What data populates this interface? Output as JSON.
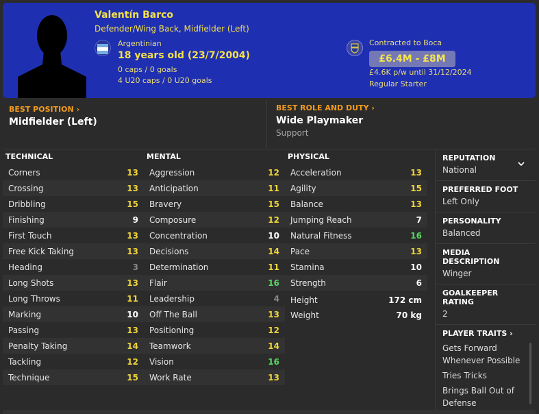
{
  "player": {
    "name": "Valentín Barco",
    "positions": "Defender/Wing Back, Midfielder (Left)",
    "nationality": "Argentinian",
    "age": "18 years old (23/7/2004)",
    "caps": "0 caps / 0 goals",
    "u20_caps": "4 U20 caps / 0 U20 goals",
    "contract": "Contracted to Boca",
    "value": "£6.4M - £8M",
    "wage": "£4.6K p/w until 31/12/2024",
    "status": "Regular Starter"
  },
  "best_position": {
    "label": "BEST POSITION ›",
    "value": "Midfielder (Left)"
  },
  "best_role": {
    "label": "BEST ROLE AND DUTY ›",
    "value": "Wide Playmaker",
    "duty": "Support"
  },
  "technical": {
    "title": "TECHNICAL",
    "rows": [
      {
        "name": "Corners",
        "value": "13",
        "color": "yellow"
      },
      {
        "name": "Crossing",
        "value": "13",
        "color": "yellow"
      },
      {
        "name": "Dribbling",
        "value": "15",
        "color": "yellow"
      },
      {
        "name": "Finishing",
        "value": "9",
        "color": "white"
      },
      {
        "name": "First Touch",
        "value": "13",
        "color": "yellow"
      },
      {
        "name": "Free Kick Taking",
        "value": "13",
        "color": "yellow"
      },
      {
        "name": "Heading",
        "value": "3",
        "color": "grey"
      },
      {
        "name": "Long Shots",
        "value": "13",
        "color": "yellow"
      },
      {
        "name": "Long Throws",
        "value": "11",
        "color": "yellow"
      },
      {
        "name": "Marking",
        "value": "10",
        "color": "white"
      },
      {
        "name": "Passing",
        "value": "13",
        "color": "yellow"
      },
      {
        "name": "Penalty Taking",
        "value": "14",
        "color": "yellow"
      },
      {
        "name": "Tackling",
        "value": "12",
        "color": "yellow"
      },
      {
        "name": "Technique",
        "value": "15",
        "color": "yellow"
      }
    ]
  },
  "mental": {
    "title": "MENTAL",
    "rows": [
      {
        "name": "Aggression",
        "value": "12",
        "color": "yellow"
      },
      {
        "name": "Anticipation",
        "value": "11",
        "color": "yellow"
      },
      {
        "name": "Bravery",
        "value": "15",
        "color": "yellow"
      },
      {
        "name": "Composure",
        "value": "12",
        "color": "yellow"
      },
      {
        "name": "Concentration",
        "value": "10",
        "color": "white"
      },
      {
        "name": "Decisions",
        "value": "14",
        "color": "yellow"
      },
      {
        "name": "Determination",
        "value": "11",
        "color": "yellow"
      },
      {
        "name": "Flair",
        "value": "16",
        "color": "green"
      },
      {
        "name": "Leadership",
        "value": "4",
        "color": "grey"
      },
      {
        "name": "Off The Ball",
        "value": "13",
        "color": "yellow"
      },
      {
        "name": "Positioning",
        "value": "12",
        "color": "yellow"
      },
      {
        "name": "Teamwork",
        "value": "14",
        "color": "yellow"
      },
      {
        "name": "Vision",
        "value": "16",
        "color": "green"
      },
      {
        "name": "Work Rate",
        "value": "13",
        "color": "yellow"
      }
    ]
  },
  "physical": {
    "title": "PHYSICAL",
    "rows": [
      {
        "name": "Acceleration",
        "value": "13",
        "color": "yellow"
      },
      {
        "name": "Agility",
        "value": "15",
        "color": "yellow"
      },
      {
        "name": "Balance",
        "value": "13",
        "color": "yellow"
      },
      {
        "name": "Jumping Reach",
        "value": "7",
        "color": "white"
      },
      {
        "name": "Natural Fitness",
        "value": "16",
        "color": "green"
      },
      {
        "name": "Pace",
        "value": "13",
        "color": "yellow"
      },
      {
        "name": "Stamina",
        "value": "10",
        "color": "white"
      },
      {
        "name": "Strength",
        "value": "6",
        "color": "white"
      }
    ],
    "height_label": "Height",
    "height": "172 cm",
    "weight_label": "Weight",
    "weight": "70 kg"
  },
  "info": {
    "reputation_label": "REPUTATION",
    "reputation": "National",
    "foot_label": "PREFERRED FOOT",
    "foot": "Left Only",
    "personality_label": "PERSONALITY",
    "personality": "Balanced",
    "media_label": "MEDIA DESCRIPTION",
    "media": "Winger",
    "gk_label": "GOALKEEPER RATING",
    "gk": "2",
    "traits_label": "PLAYER TRAITS ›",
    "traits": [
      "Gets Forward Whenever Possible",
      "Tries Tricks",
      "Brings Ball Out of Defense"
    ]
  },
  "colors": {
    "header_bg": "#1f2fb2",
    "accent_orange": "#f29b1e",
    "yellow": "#f0d53a",
    "green": "#56d95f",
    "grey": "#8a8a8a"
  },
  "icons": {
    "avatar": "player-silhouette-icon",
    "flag": "argentina-flag-icon",
    "crest": "club-crest-icon",
    "dropdown": "chevron-down-icon"
  }
}
